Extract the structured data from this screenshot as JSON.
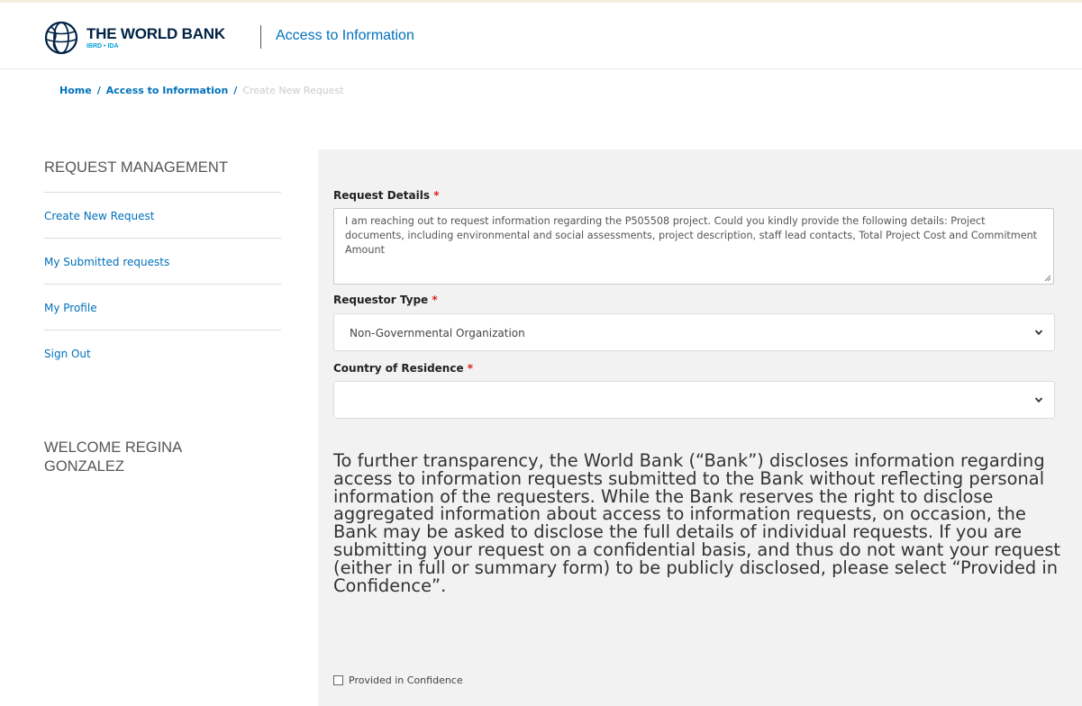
{
  "header": {
    "brand_name": "THE WORLD BANK",
    "brand_sub": "IBRD • IDA",
    "section_title": "Access to Information"
  },
  "breadcrumb": {
    "items": [
      "Home",
      "Access to Information",
      "Create New Request"
    ]
  },
  "sidebar": {
    "title": "REQUEST MANAGEMENT",
    "items": [
      {
        "label": "Create New Request"
      },
      {
        "label": "My Submitted requests"
      },
      {
        "label": "My Profile"
      },
      {
        "label": "Sign Out"
      }
    ],
    "welcome": "WELCOME REGINA GONZALEZ"
  },
  "form": {
    "required_mark": "*",
    "request_details": {
      "label": "Request Details",
      "value": "I am reaching out to request information regarding the P505508 project. Could you kindly provide the following details: Project documents, including environmental and social assessments, project description, staff lead contacts, Total Project Cost and Commitment Amount"
    },
    "requestor_type": {
      "label": "Requestor Type",
      "value": "Non-Governmental Organization"
    },
    "country": {
      "label": "Country of Residence",
      "value": ""
    },
    "disclosure_text": "To further transparency, the World Bank (“Bank”) discloses information regarding access to information requests submitted to the Bank without reflecting personal information of the requesters. While the Bank reserves the right to disclose aggregated information about access to information requests, on occasion, the Bank may be asked to disclose the full details of individual requests. If you are submitting your request on a confidential basis, and thus do not want your request (either in full or summary form) to be publicly disclosed, please select “Provided in Confidence”.",
    "confidence_checkbox": {
      "label": "Provided in Confidence",
      "checked": false
    }
  },
  "colors": {
    "link": "#0071bc",
    "required": "#d9211f",
    "panel_bg": "#f2f2f2",
    "brand_navy": "#002244"
  }
}
